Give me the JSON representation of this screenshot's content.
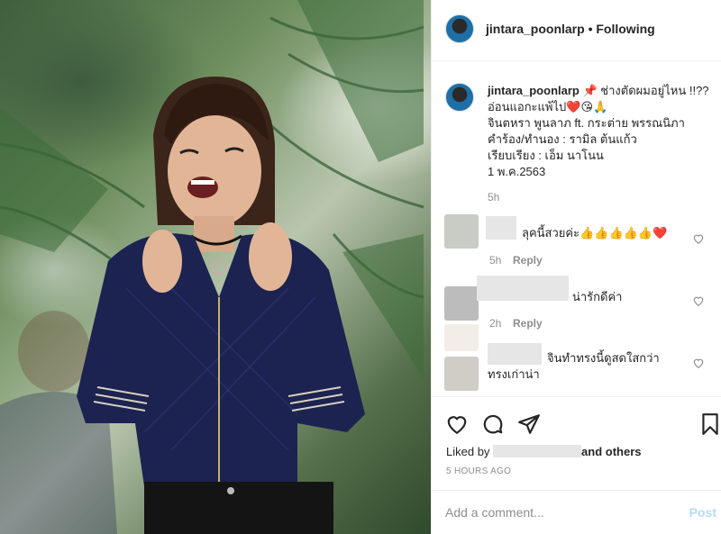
{
  "header": {
    "username": "jintara_poonlarp",
    "separator": "•",
    "follow_status": "Following"
  },
  "caption": {
    "username": "jintara_poonlarp",
    "text1": "📌 ช่างตัดผมอยู่ไหน !!?? อ่อนแอกะแพ้ไป",
    "emojis": "❤️😘🙏",
    "line2": "จินตหรา พูนลาภ ft. กระต่าย พรรณนิภา",
    "line3": "คำร้อง/ทำนอง : รามิล ต้นแก้ว",
    "line4": "เรียบเรียง : เอ็ม นาโนน",
    "line5": "1 พ.ค.2563",
    "time": "5h"
  },
  "comments": [
    {
      "text": "ลุคนี้สวยค่ะ👍👍👍👍👍❤️",
      "time": "5h",
      "reply": "Reply"
    },
    {
      "text": "น่ารักดีค่า",
      "time": "2h",
      "reply": "Reply"
    },
    {
      "text": "จินทำทรงนี้ดูสดใสกว่า ทรงเก่าน่า",
      "time": "",
      "reply": ""
    }
  ],
  "likes": {
    "prefix": "Liked by",
    "and_others": "and others"
  },
  "timestamp": "5 HOURS AGO",
  "add_comment": {
    "placeholder": "Add a comment...",
    "post_label": "Post"
  },
  "colors": {
    "link": "#b3dbff",
    "muted": "#8e8e8e",
    "text": "#262626"
  }
}
